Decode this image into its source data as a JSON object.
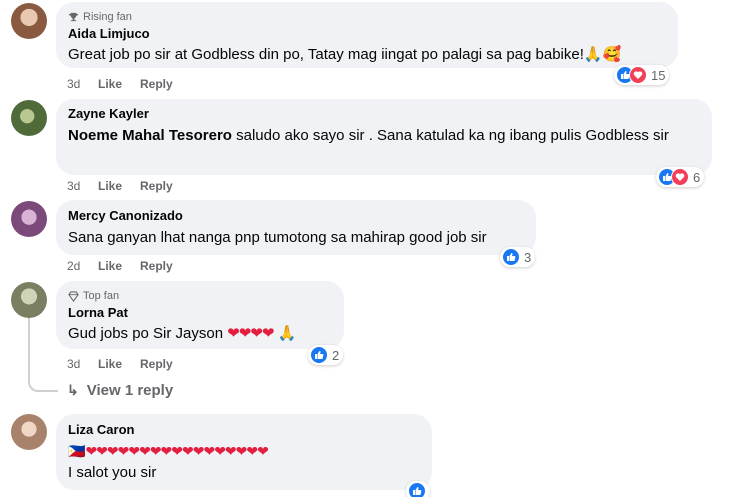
{
  "comments": [
    {
      "badge": "Rising fan",
      "name": "Aida Limjuco",
      "text": "Great job po sir at Godbless din po, Tatay mag iingat po palagi sa pag babike!",
      "emoji": "🙏🥰",
      "time": "3d",
      "like": "Like",
      "reply": "Reply",
      "reactions": "15",
      "avatar_color": "#c9a48a"
    },
    {
      "name": "Zayne Kayler",
      "mention": "Noeme Mahal Tesorero",
      "text": " saludo ako sayo sir . Sana katulad ka ng ibang pulis Godbless sir",
      "time": "3d",
      "like": "Like",
      "reply": "Reply",
      "reactions": "6",
      "avatar_color": "#6f8c5a"
    },
    {
      "name": "Mercy Canonizado",
      "text": "Sana ganyan lhat nanga pnp tumotong sa mahirap good job sir",
      "time": "2d",
      "like": "Like",
      "reply": "Reply",
      "reactions": "3",
      "avatar_color": "#9a6fa3"
    },
    {
      "badge": "Top fan",
      "name": "Lorna Pat",
      "text": "Gud jobs po Sir Jayson",
      "emoji_hearts": "❤❤❤❤",
      "emoji_tail": "🙏",
      "time": "3d",
      "like": "Like",
      "reply": "Reply",
      "reactions": "2",
      "avatar_color": "#9fa68a"
    },
    {
      "name": "Liza Caron",
      "flag": "🇵🇭",
      "hearts_line": "❤❤❤❤❤❤❤❤❤❤❤❤❤❤❤❤❤",
      "text": "I salot you sir",
      "avatar_color": "#d7b7a0"
    }
  ],
  "view_replies": "View 1 reply",
  "colors": {
    "bubble": "#f0f2f5",
    "like_blue": "#1877f2",
    "love_red": "#f33e58",
    "meta_gray": "#65676b"
  }
}
